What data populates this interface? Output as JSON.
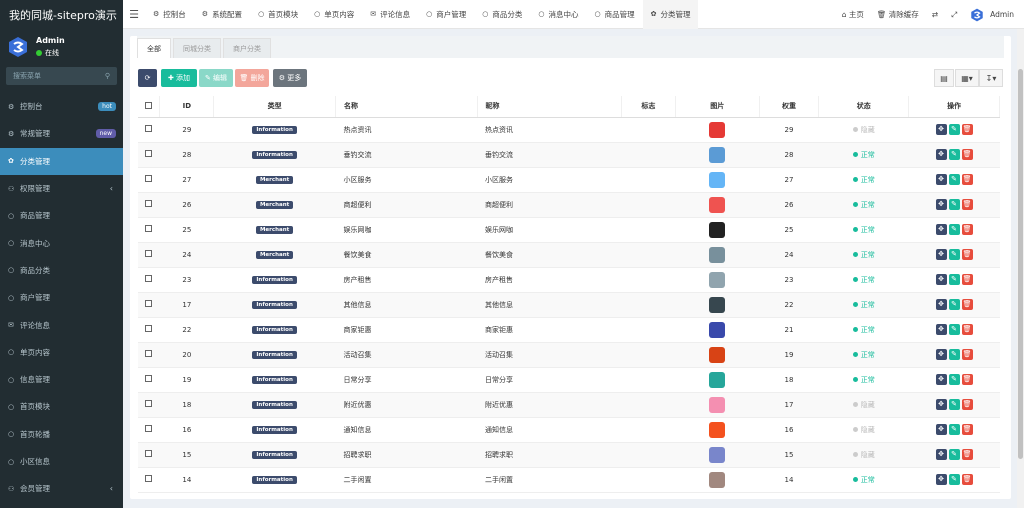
{
  "app_title": "我的同城-sitepro演示",
  "user": {
    "name": "Admin",
    "status": "在线"
  },
  "search_placeholder": "搜索菜单",
  "menu": [
    {
      "label": "控制台",
      "badge": "hot",
      "badge_color": "#3c8dbc",
      "icon": "dashboard-icon"
    },
    {
      "label": "常规管理",
      "badge": "new",
      "badge_color": "#605ca8",
      "icon": "gears-icon"
    },
    {
      "label": "分类管理",
      "active": true,
      "icon": "leaf-icon"
    },
    {
      "label": "权限管理",
      "arrow": true,
      "icon": "group-icon"
    },
    {
      "label": "商品管理",
      "icon": "circle-icon"
    },
    {
      "label": "消息中心",
      "icon": "circle-icon"
    },
    {
      "label": "商品分类",
      "icon": "circle-icon"
    },
    {
      "label": "商户管理",
      "icon": "circle-icon"
    },
    {
      "label": "评论信息",
      "icon": "comment-icon"
    },
    {
      "label": "单页内容",
      "icon": "circle-icon"
    },
    {
      "label": "信息管理",
      "icon": "circle-icon"
    },
    {
      "label": "首页模块",
      "icon": "circle-icon"
    },
    {
      "label": "首页轮播",
      "icon": "circle-icon"
    },
    {
      "label": "小区信息",
      "icon": "circle-icon"
    },
    {
      "label": "会员管理",
      "arrow": true,
      "icon": "user-icon"
    }
  ],
  "top_tabs": [
    {
      "label": "控制台",
      "icon": "dashboard-icon"
    },
    {
      "label": "系统配置",
      "icon": "cog-icon"
    },
    {
      "label": "首页模块",
      "icon": "circle-icon"
    },
    {
      "label": "单页内容",
      "icon": "circle-icon"
    },
    {
      "label": "评论信息",
      "icon": "comment-icon"
    },
    {
      "label": "商户管理",
      "icon": "circle-icon"
    },
    {
      "label": "商品分类",
      "icon": "circle-icon"
    },
    {
      "label": "消息中心",
      "icon": "circle-icon"
    },
    {
      "label": "商品管理",
      "icon": "circle-icon"
    },
    {
      "label": "分类管理",
      "icon": "leaf-icon",
      "active": true
    }
  ],
  "top_right": {
    "home": "主页",
    "clear_cache": "清除缓存",
    "admin": "Admin"
  },
  "content_tabs": [
    "全部",
    "同城分类",
    "商户分类"
  ],
  "toolbar": {
    "add": "添加",
    "edit": "编辑",
    "delete": "删除",
    "more": "更多"
  },
  "table": {
    "headers": [
      "ID",
      "类型",
      "名称",
      "昵称",
      "标志",
      "图片",
      "权重",
      "状态",
      "操作"
    ],
    "rows": [
      {
        "id": "29",
        "type": "Information",
        "name": "热点资讯",
        "nick": "热点资讯",
        "weight": "29",
        "status": "隐藏",
        "img_color": "#e53935"
      },
      {
        "id": "28",
        "type": "Information",
        "name": "垂钓交流",
        "nick": "垂钓交流",
        "weight": "28",
        "status": "正常",
        "img_color": "#5b9bd5"
      },
      {
        "id": "27",
        "type": "Merchant",
        "name": "小区服务",
        "nick": "小区服务",
        "weight": "27",
        "status": "正常",
        "img_color": "#64b5f6"
      },
      {
        "id": "26",
        "type": "Merchant",
        "name": "商超便利",
        "nick": "商超便利",
        "weight": "26",
        "status": "正常",
        "img_color": "#ef5350"
      },
      {
        "id": "25",
        "type": "Merchant",
        "name": "娱乐网咖",
        "nick": "娱乐网咖",
        "weight": "25",
        "status": "正常",
        "img_color": "#212121"
      },
      {
        "id": "24",
        "type": "Merchant",
        "name": "餐饮美食",
        "nick": "餐饮美食",
        "weight": "24",
        "status": "正常",
        "img_color": "#78909c"
      },
      {
        "id": "23",
        "type": "Information",
        "name": "房产租售",
        "nick": "房产租售",
        "weight": "23",
        "status": "正常",
        "img_color": "#90a4ae"
      },
      {
        "id": "17",
        "type": "Information",
        "name": "其他信息",
        "nick": "其他信息",
        "weight": "22",
        "status": "正常",
        "img_color": "#37474f"
      },
      {
        "id": "22",
        "type": "Information",
        "name": "商家钜惠",
        "nick": "商家钜惠",
        "weight": "21",
        "status": "正常",
        "img_color": "#3949ab"
      },
      {
        "id": "20",
        "type": "Information",
        "name": "活动召集",
        "nick": "活动召集",
        "weight": "19",
        "status": "正常",
        "img_color": "#d84315"
      },
      {
        "id": "19",
        "type": "Information",
        "name": "日常分享",
        "nick": "日常分享",
        "weight": "18",
        "status": "正常",
        "img_color": "#26a69a"
      },
      {
        "id": "18",
        "type": "Information",
        "name": "附近优惠",
        "nick": "附近优惠",
        "weight": "17",
        "status": "隐藏",
        "img_color": "#f48fb1"
      },
      {
        "id": "16",
        "type": "Information",
        "name": "通知信息",
        "nick": "通知信息",
        "weight": "16",
        "status": "隐藏",
        "img_color": "#f4511e"
      },
      {
        "id": "15",
        "type": "Information",
        "name": "招聘求职",
        "nick": "招聘求职",
        "weight": "15",
        "status": "隐藏",
        "img_color": "#7986cb"
      },
      {
        "id": "14",
        "type": "Information",
        "name": "二手闲置",
        "nick": "二手闲置",
        "weight": "14",
        "status": "正常",
        "img_color": "#a1887f"
      }
    ]
  }
}
